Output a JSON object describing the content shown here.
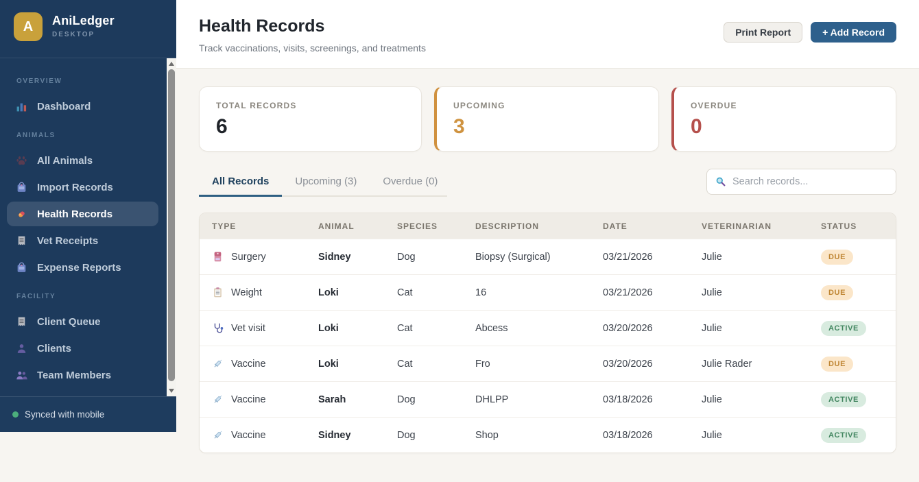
{
  "app": {
    "name": "AniLedger",
    "edition": "DESKTOP",
    "logo_letter": "A"
  },
  "sidebar": {
    "sections": [
      {
        "label": "OVERVIEW",
        "items": [
          {
            "label": "Dashboard",
            "icon": "bar-chart-icon",
            "active": false
          }
        ]
      },
      {
        "label": "ANIMALS",
        "items": [
          {
            "label": "All Animals",
            "icon": "paw-icon",
            "active": false
          },
          {
            "label": "Import Records",
            "icon": "import-box-icon",
            "active": false
          },
          {
            "label": "Health Records",
            "icon": "pill-icon",
            "active": true
          },
          {
            "label": "Vet Receipts",
            "icon": "receipt-icon",
            "active": false
          },
          {
            "label": "Expense Reports",
            "icon": "expense-box-icon",
            "active": false
          }
        ]
      },
      {
        "label": "FACILITY",
        "items": [
          {
            "label": "Client Queue",
            "icon": "receipt-icon",
            "active": false
          },
          {
            "label": "Clients",
            "icon": "person-icon",
            "active": false
          },
          {
            "label": "Team Members",
            "icon": "people-icon",
            "active": false
          }
        ]
      }
    ],
    "footer": {
      "status": "Synced with mobile"
    }
  },
  "header": {
    "title": "Health Records",
    "subtitle": "Track vaccinations, visits, screenings, and treatments",
    "print_button": "Print Report",
    "add_button": "+ Add Record"
  },
  "stats": [
    {
      "label": "TOTAL RECORDS",
      "value": "6",
      "accent": null
    },
    {
      "label": "UPCOMING",
      "value": "3",
      "accent": "#d0913f"
    },
    {
      "label": "OVERDUE",
      "value": "0",
      "accent": "#b5504c"
    }
  ],
  "tabs": [
    {
      "label": "All Records",
      "active": true
    },
    {
      "label": "Upcoming (3)",
      "active": false
    },
    {
      "label": "Overdue (0)",
      "active": false
    }
  ],
  "search": {
    "placeholder": "Search records...",
    "icon": "search-icon"
  },
  "table": {
    "columns": [
      "TYPE",
      "ANIMAL",
      "SPECIES",
      "DESCRIPTION",
      "DATE",
      "VETERINARIAN",
      "STATUS"
    ],
    "rows": [
      {
        "icon": "surgery-icon",
        "type": "Surgery",
        "animal": "Sidney",
        "species": "Dog",
        "description": "Biopsy (Surgical)",
        "date": "03/21/2026",
        "veterinarian": "Julie",
        "status": "DUE"
      },
      {
        "icon": "clipboard-icon",
        "type": "Weight",
        "animal": "Loki",
        "species": "Cat",
        "description": "16",
        "date": "03/21/2026",
        "veterinarian": "Julie",
        "status": "DUE"
      },
      {
        "icon": "stethoscope-icon",
        "type": "Vet visit",
        "animal": "Loki",
        "species": "Cat",
        "description": "Abcess",
        "date": "03/20/2026",
        "veterinarian": "Julie",
        "status": "ACTIVE"
      },
      {
        "icon": "syringe-icon",
        "type": "Vaccine",
        "animal": "Loki",
        "species": "Cat",
        "description": "Fro",
        "date": "03/20/2026",
        "veterinarian": "Julie Rader",
        "status": "DUE"
      },
      {
        "icon": "syringe-icon",
        "type": "Vaccine",
        "animal": "Sarah",
        "species": "Dog",
        "description": "DHLPP",
        "date": "03/18/2026",
        "veterinarian": "Julie",
        "status": "ACTIVE"
      },
      {
        "icon": "syringe-icon",
        "type": "Vaccine",
        "animal": "Sidney",
        "species": "Dog",
        "description": "Shop",
        "date": "03/18/2026",
        "veterinarian": "Julie",
        "status": "ACTIVE"
      }
    ]
  },
  "colors": {
    "sidebar_bg": "#1d3a5c",
    "logo_gold": "#c9a13b",
    "primary_button_blue": "#2e608c",
    "upcoming_accent": "#d0913f",
    "overdue_accent": "#b5504c",
    "badge_due_bg": "#fbe6c9",
    "badge_due_text": "#bf8634",
    "badge_active_bg": "#d8ebdf",
    "badge_active_text": "#41855f",
    "synced_dot_green": "#4cae7c"
  }
}
